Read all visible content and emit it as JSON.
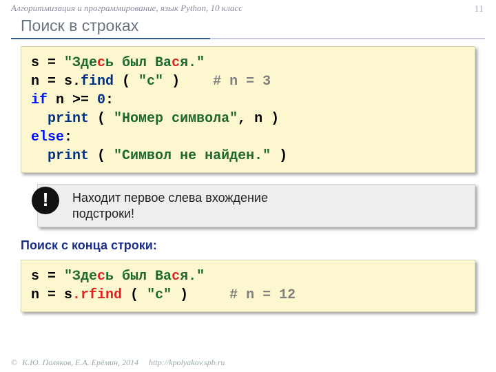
{
  "header": {
    "breadcrumb": "Алгоритмизация и программирование, язык Python, 10 класс",
    "page_number": "11",
    "title": "Поиск в строках"
  },
  "code1": {
    "l1_a": "s = ",
    "l1_str_a": "\"Зде",
    "l1_hl": "с",
    "l1_str_b": "ь был Ва",
    "l1_hl2": "с",
    "l1_str_c": "я.\"",
    "l2_a": "n = s.",
    "l2_fn": "find",
    "l2_b": " ( ",
    "l2_arg": "\"с\"",
    "l2_c": " )    ",
    "l2_com": "# n = 3",
    "l3_if": "if",
    "l3_a": " n >= ",
    "l3_num": "0",
    "l3_b": ":",
    "l4_pad": "  ",
    "l4_fn": "print",
    "l4_a": " ( ",
    "l4_str": "\"Номер символа\"",
    "l4_b": ", n ) ",
    "l5_else": "else",
    "l5_a": ":",
    "l6_pad": "  ",
    "l6_fn": "print",
    "l6_a": " ( ",
    "l6_str": "\"Символ не найден.\"",
    "l6_b": " ) "
  },
  "note": {
    "icon": "!",
    "text_a": "Находит первое слева вхождение",
    "text_b": "подстроки!"
  },
  "sub_heading": "Поиск с конца строки:",
  "code2": {
    "l1_a": "s = ",
    "l1_str_a": "\"Зде",
    "l1_hl": "с",
    "l1_str_b": "ь был Ва",
    "l1_hl2": "с",
    "l1_str_c": "я.\"",
    "l2_a": "n = s",
    "l2_dot": ".",
    "l2_fn": "rfind",
    "l2_b": " ( ",
    "l2_arg": "\"с\"",
    "l2_c": " )     ",
    "l2_com": "# n = 12"
  },
  "footer": {
    "copy": "©",
    "authors": "К.Ю. Поляков, Е.А. Ерёмин, 2014",
    "url": "http://kpolyakov.spb.ru"
  }
}
